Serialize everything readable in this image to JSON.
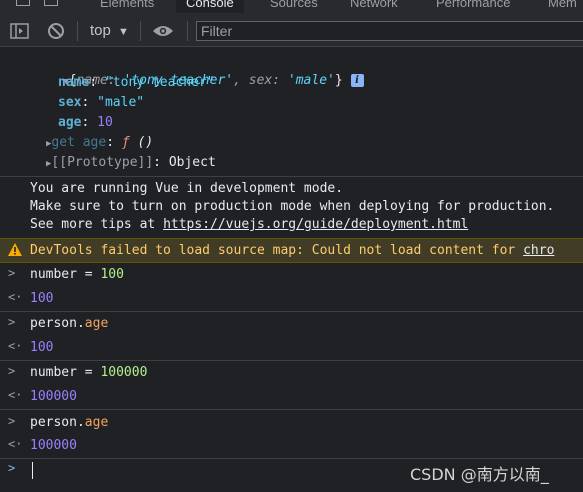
{
  "tabs": [
    "Elements",
    "Console",
    "Sources",
    "Network",
    "Performance",
    "Mem"
  ],
  "toolbar": {
    "context": "top",
    "filter_placeholder": "Filter"
  },
  "object": {
    "summary_open": "{",
    "summary_k1": "name",
    "summary_v1": "'tony teacher'",
    "summary_k2": "sex",
    "summary_v2": "'male'",
    "summary_close": "}",
    "props": [
      {
        "key": "name",
        "value": "\"tony teacher\""
      },
      {
        "key": "sex",
        "value": "\"male\""
      },
      {
        "key": "age",
        "value": "10"
      }
    ],
    "getter_label": "get age",
    "getter_fn": "ƒ",
    "getter_parens": "()",
    "proto_label": "[[Prototype]]",
    "proto_value": "Object"
  },
  "vue_notice": [
    "You are running Vue in development mode.",
    "Make sure to turn on production mode when deploying for production.",
    "See more tips at "
  ],
  "vue_link": "https://vuejs.org/guide/deployment.html",
  "warning": {
    "text": "DevTools failed to load source map: Could not load content for ",
    "link": "chro"
  },
  "entries": [
    {
      "input_var": "number",
      "input_op": " = ",
      "input_val": "100",
      "result": "100"
    },
    {
      "input_var": "person.",
      "input_prop": "age",
      "result": "100"
    },
    {
      "input_var": "number",
      "input_op": " = ",
      "input_val": "100000",
      "result": "100000"
    },
    {
      "input_var": "person.",
      "input_prop": "age",
      "result": "100000"
    }
  ],
  "watermark": "CSDN @南方以南_",
  "colors": {
    "background": "#202124",
    "toolbar": "#292a2d",
    "warning_bg": "#413c26",
    "warning_text": "#ffcb6b",
    "number": "#9980ff",
    "accent": "#8ab4f8"
  },
  "icons": [
    "dock-sidebar-icon",
    "clear-console-icon",
    "dropdown-arrow-icon",
    "eye-icon",
    "warning-icon",
    "expand-triangle-icon",
    "info-badge-icon",
    "input-chevron-icon",
    "output-arrow-icon",
    "prompt-chevron-icon"
  ]
}
